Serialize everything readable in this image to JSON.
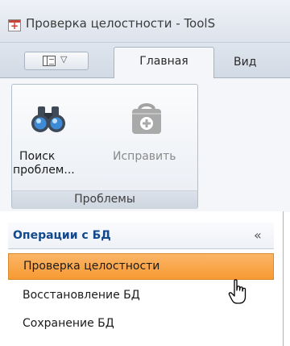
{
  "window": {
    "title": "Проверка целостности - ToolS"
  },
  "ribbon": {
    "tabs": {
      "home": "Главная",
      "view": "Вид"
    },
    "group": {
      "label": "Проблемы",
      "buttons": {
        "search": {
          "line1": "Поиск",
          "line2": "проблем..."
        },
        "fix": {
          "label": "Исправить"
        }
      }
    }
  },
  "nav": {
    "header": "Операции с БД",
    "collapse_glyph": "«",
    "items": [
      {
        "label": "Проверка целостности",
        "selected": true
      },
      {
        "label": "Восстановление БД",
        "selected": false
      },
      {
        "label": "Сохранение БД",
        "selected": false
      }
    ]
  },
  "icons": {
    "app": "app-icon",
    "pane_toggle": "pane-toggle-icon",
    "dropdown": "chevron-down-icon",
    "search": "binoculars-icon",
    "fix": "repair-kit-icon",
    "collapse": "collapse-icon",
    "cursor": "hand-pointer-icon"
  },
  "colors": {
    "selected_item": "#f79a33",
    "header_text": "#13498c",
    "disabled_text": "#8a8a8a",
    "app_icon_accent": "#d23a2a"
  }
}
